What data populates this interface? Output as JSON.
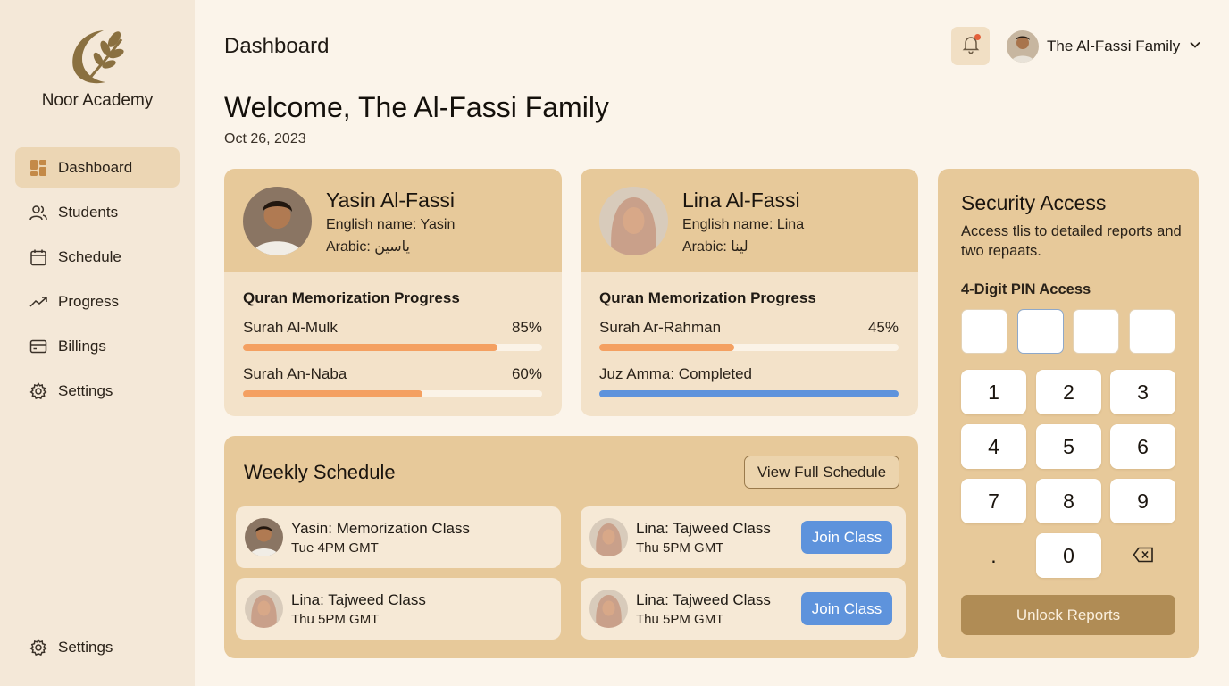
{
  "brand": {
    "name": "Noor Academy"
  },
  "sidebar": {
    "items": [
      {
        "label": "Dashboard",
        "icon": "dashboard-icon",
        "active": true
      },
      {
        "label": "Students",
        "icon": "users-icon"
      },
      {
        "label": "Schedule",
        "icon": "calendar-icon"
      },
      {
        "label": "Progress",
        "icon": "trend-icon"
      },
      {
        "label": "Billings",
        "icon": "card-icon"
      },
      {
        "label": "Settings",
        "icon": "gear-icon"
      }
    ],
    "footer_label": "Settings"
  },
  "header": {
    "title": "Dashboard",
    "user_name": "The Al-Fassi Family",
    "has_notification": true
  },
  "welcome": {
    "heading": "Welcome, The Al-Fassi Family",
    "date": "Oct 26, 2023"
  },
  "students": [
    {
      "name": "Yasin Al-Fassi",
      "english": "English name: Yasin",
      "arabic": "Arabic: ياسين",
      "progress_title": "Quran Memorization Progress",
      "items": [
        {
          "label": "Surah Al-Mulk",
          "value": "85%",
          "fraction": 0.85
        },
        {
          "label": "Surah An-Naba",
          "value": "60%",
          "fraction": 0.6
        }
      ]
    },
    {
      "name": "Lina Al-Fassi",
      "english": "English name: Lina",
      "arabic": "Arabic: لينا",
      "progress_title": "Quran Memorization Progress",
      "items": [
        {
          "label": "Surah Ar-Rahman",
          "value": "45%",
          "fraction": 0.45
        },
        {
          "label": "Juz Amma: Completed",
          "value": "",
          "fraction": 1.0
        }
      ]
    }
  ],
  "schedule": {
    "title": "Weekly Schedule",
    "view_full": "View Full Schedule",
    "items": [
      {
        "class": "Yasin: Memorization Class",
        "time": "Tue 4PM GMT",
        "join": ""
      },
      {
        "class": "Lina: Tajweed Class",
        "time": "Thu 5PM GMT",
        "join": "Join Class"
      },
      {
        "class": "Lina: Tajweed Class",
        "time": "Thu 5PM GMT",
        "join": ""
      },
      {
        "class": "Lina: Tajweed Class",
        "time": "Thu 5PM GMT",
        "join": "Join Class"
      }
    ]
  },
  "security": {
    "title": "Security Access",
    "description": "Access tlis to detailed reports and two repaats.",
    "pin_label": "4-Digit PIN Access",
    "keys": [
      "1",
      "2",
      "3",
      "4",
      "5",
      "6",
      "7",
      "8",
      "9",
      ".",
      "0"
    ],
    "unlock": "Unlock Reports"
  },
  "colors": {
    "accent": "#e7c99a",
    "progress_orange": "#f4a061",
    "progress_blue": "#5e93dc",
    "unlock": "#b08c55",
    "notification": "#e3603a"
  }
}
